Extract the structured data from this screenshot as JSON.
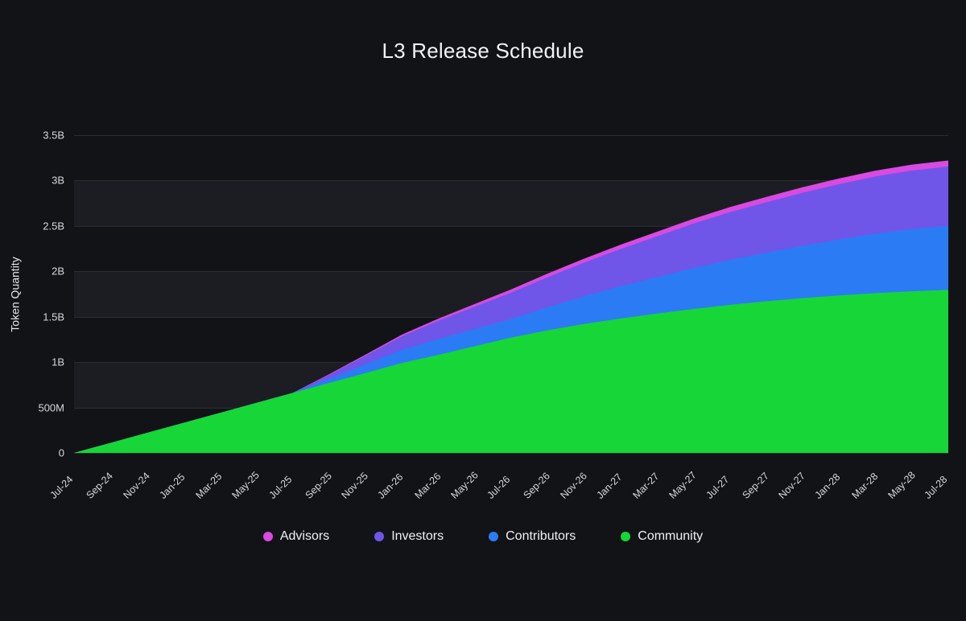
{
  "chart_data": {
    "type": "area",
    "stacked": true,
    "title": "L3 Release Schedule",
    "xlabel": "",
    "ylabel": "Token Quantity",
    "ylim": [
      0,
      3500000000
    ],
    "grid": true,
    "legend_position": "bottom",
    "y_ticks": [
      {
        "label": "0",
        "value": 0
      },
      {
        "label": "500M",
        "value": 500000000
      },
      {
        "label": "1B",
        "value": 1000000000
      },
      {
        "label": "1.5B",
        "value": 1500000000
      },
      {
        "label": "2B",
        "value": 2000000000
      },
      {
        "label": "2.5B",
        "value": 2500000000
      },
      {
        "label": "3B",
        "value": 3000000000
      },
      {
        "label": "3.5B",
        "value": 3500000000
      }
    ],
    "categories": [
      "Jul-24",
      "Sep-24",
      "Nov-24",
      "Jan-25",
      "Mar-25",
      "May-25",
      "Jul-25",
      "Sep-25",
      "Nov-25",
      "Jan-26",
      "Mar-26",
      "May-26",
      "Jul-26",
      "Sep-26",
      "Nov-26",
      "Jan-27",
      "Mar-27",
      "May-27",
      "Jul-27",
      "Sep-27",
      "Nov-27",
      "Jan-28",
      "Mar-28",
      "May-28",
      "Jul-28"
    ],
    "series": [
      {
        "name": "Community",
        "color": "#17d637",
        "values": [
          0,
          110000000,
          220000000,
          330000000,
          440000000,
          550000000,
          660000000,
          770000000,
          880000000,
          990000000,
          1080000000,
          1175000000,
          1270000000,
          1350000000,
          1420000000,
          1480000000,
          1535000000,
          1585000000,
          1630000000,
          1670000000,
          1705000000,
          1735000000,
          1760000000,
          1780000000,
          1795000000
        ]
      },
      {
        "name": "Contributors",
        "color": "#2b7bf5",
        "values": [
          0,
          0,
          0,
          0,
          0,
          0,
          0,
          45000000,
          95000000,
          145000000,
          175000000,
          190000000,
          205000000,
          255000000,
          305000000,
          355000000,
          400000000,
          450000000,
          495000000,
          535000000,
          575000000,
          615000000,
          655000000,
          685000000,
          705000000
        ]
      },
      {
        "name": "Investors",
        "color": "#6f56e8",
        "values": [
          0,
          0,
          0,
          0,
          0,
          0,
          0,
          45000000,
          95000000,
          150000000,
          200000000,
          245000000,
          290000000,
          330000000,
          370000000,
          410000000,
          450000000,
          490000000,
          525000000,
          555000000,
          585000000,
          610000000,
          630000000,
          645000000,
          655000000
        ]
      },
      {
        "name": "Advisors",
        "color": "#d94ae0",
        "values": [
          0,
          0,
          0,
          0,
          0,
          0,
          0,
          6000000,
          12000000,
          18000000,
          24000000,
          30000000,
          36000000,
          40000000,
          44000000,
          48000000,
          51000000,
          54000000,
          57000000,
          59000000,
          61000000,
          63000000,
          64000000,
          65000000,
          66000000
        ]
      }
    ],
    "stack_order_bottom_to_top": [
      "Community",
      "Contributors",
      "Investors",
      "Advisors"
    ]
  },
  "legend": {
    "items": [
      {
        "label": "Advisors",
        "color": "#d94ae0"
      },
      {
        "label": "Investors",
        "color": "#6f56e8"
      },
      {
        "label": "Contributors",
        "color": "#2b7bf5"
      },
      {
        "label": "Community",
        "color": "#17d637"
      }
    ]
  },
  "theme": {
    "background": "#121317",
    "band_color": "#1b1d22",
    "gridline_color": "#2a2d33",
    "text_color": "#d6d8dd",
    "title_color": "#f2f3f5"
  }
}
